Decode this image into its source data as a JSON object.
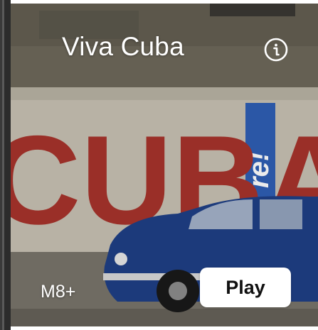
{
  "tile": {
    "title": "Viva Cuba",
    "rating": "M8+",
    "play_label": "Play",
    "wall_text": "CUBA",
    "sign_text": "re!",
    "info_icon": "info-circle-icon"
  },
  "colors": {
    "wall": "#c9c3b4",
    "letters": "#a8342c",
    "sign": "#2f5fb5",
    "car": "#1f3f86",
    "button_bg": "#ffffff",
    "button_text": "#111111"
  }
}
